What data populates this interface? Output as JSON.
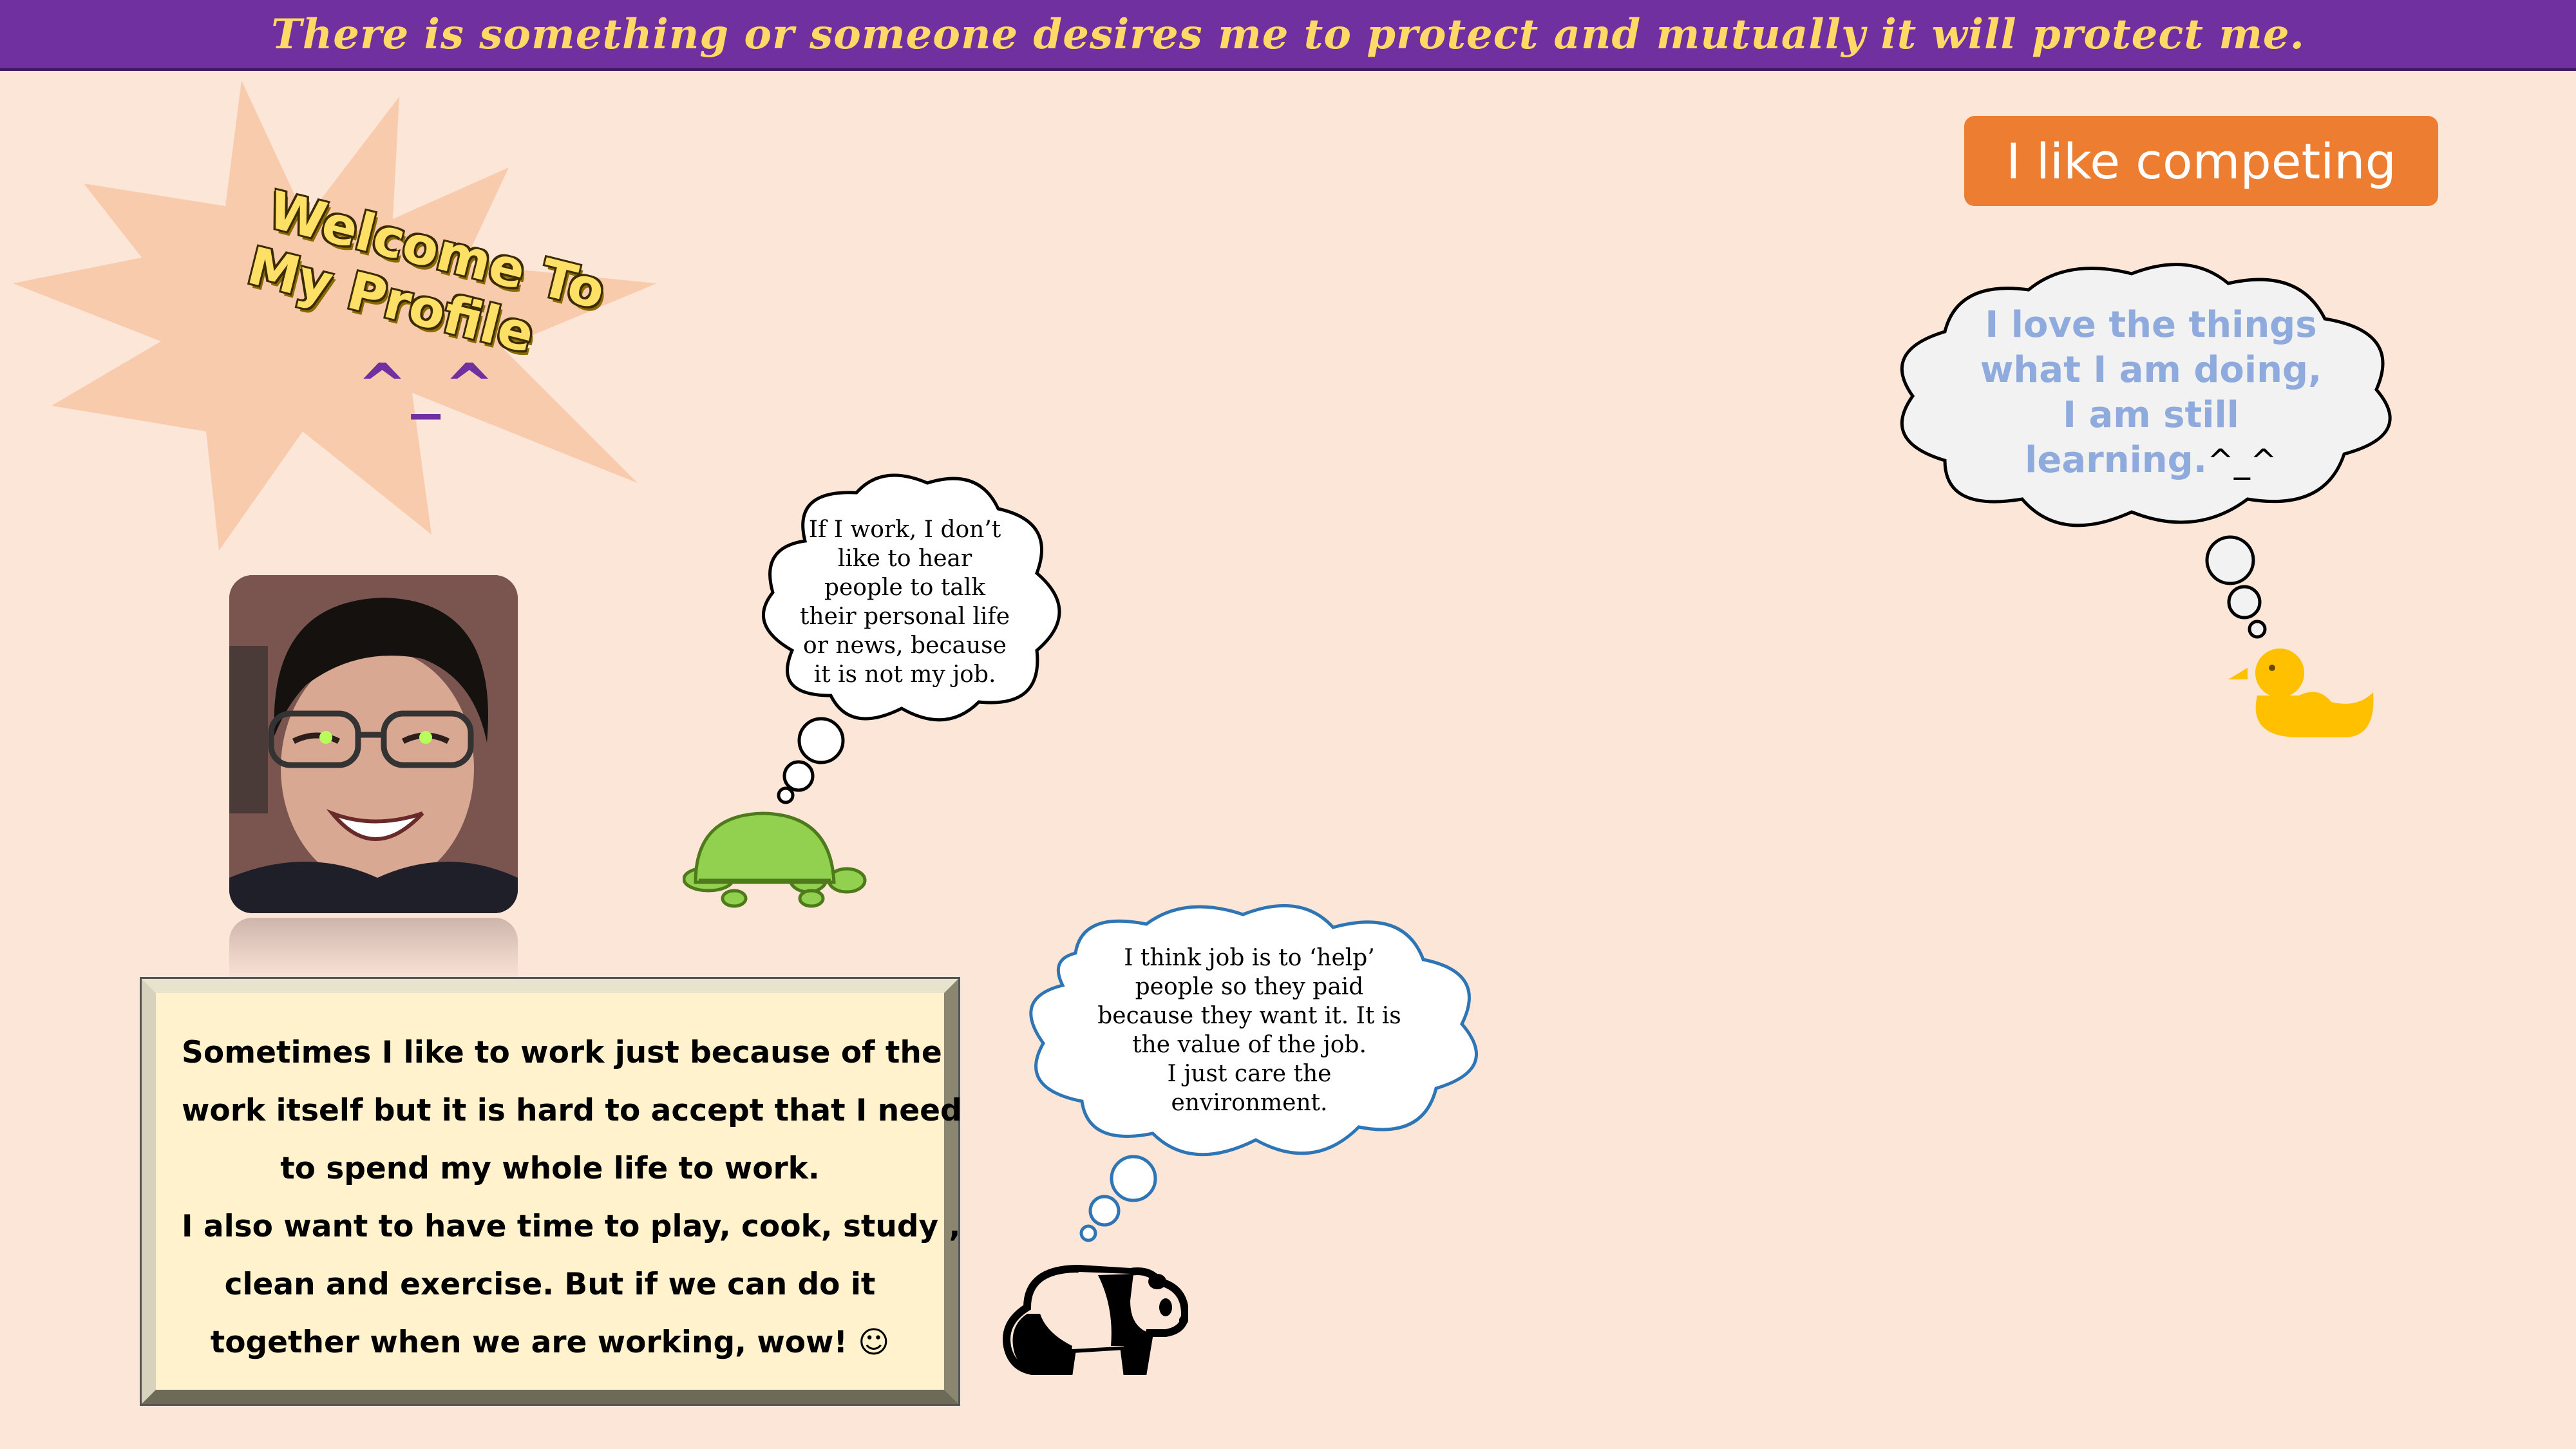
{
  "banner": {
    "text": "There is something or someone desires me to protect and mutually it will protect me."
  },
  "welcome": {
    "line1": "Welcome To",
    "line2": "My Profile",
    "smiley": "^_^"
  },
  "profile_photo": {
    "alt": "Smiling person wearing glasses"
  },
  "quote": {
    "lines": [
      "Sometimes I like to work just because of the",
      "work itself but it is hard to accept that I need",
      "to spend my whole life to work.",
      "I also want to have time to play, cook, study ,",
      "clean and exercise. But if we can do it",
      "together when we are working, wow! ☺"
    ]
  },
  "turtle_thought": {
    "lines": [
      "If I work, I don’t",
      "like to hear",
      "people to talk",
      "their personal life",
      "or news, because",
      "it is not my job."
    ]
  },
  "panda_thought": {
    "lines": [
      "I think job is to ‘help’",
      "people so they paid",
      "because they want it. It is",
      "the value of the job.",
      "I just care the",
      "environment."
    ]
  },
  "competing_button": {
    "label": "I like competing"
  },
  "duck_thought": {
    "lines": [
      "I love the things",
      "what I am doing,",
      "I am still",
      "learning."
    ],
    "suffix": "^_^"
  },
  "icons": [
    "star-burst",
    "turtle-icon",
    "panda-icon",
    "duck-icon"
  ],
  "colors": {
    "background": "#fce6d8",
    "banner": "#7030a0",
    "banner_text": "#ffd966",
    "star": "#f8cbad",
    "button": "#ed7d31",
    "turtle": "#92d050",
    "duck": "#ffc000",
    "duck_text": "#8faadc"
  }
}
